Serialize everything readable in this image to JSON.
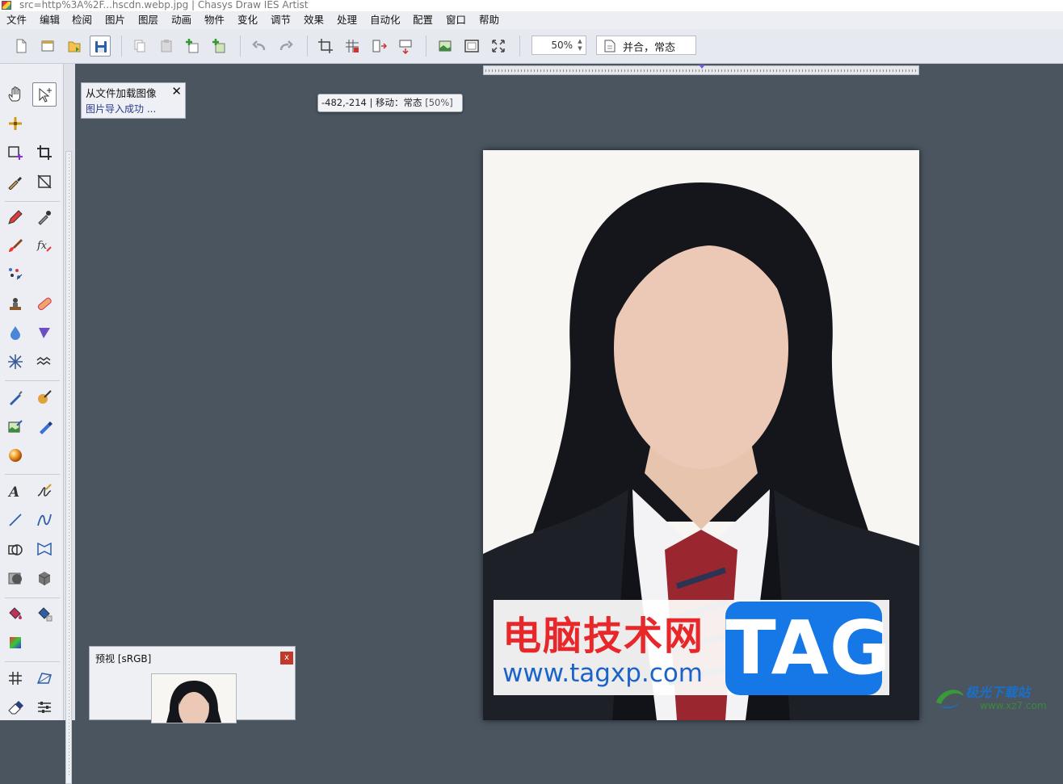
{
  "window": {
    "title": "src=http%3A%2F...hscdn.webp.jpg | Chasys Draw IES Artist"
  },
  "menu": [
    "文件",
    "编辑",
    "检阅",
    "图片",
    "图层",
    "动画",
    "物件",
    "变化",
    "调节",
    "效果",
    "处理",
    "自动化",
    "配置",
    "窗口",
    "帮助"
  ],
  "toolbar": {
    "zoom_value": "50%",
    "blend_mode": "并合，常态",
    "buttons": [
      "new",
      "open",
      "open-folder",
      "save",
      "copy",
      "paste",
      "add-layer",
      "add-layer-from",
      "undo",
      "redo",
      "crop",
      "grid",
      "flip-horizontal",
      "flip-vertical",
      "image",
      "frame",
      "fit-screen"
    ]
  },
  "left_tools": [
    "hand",
    "move-select",
    "add-point",
    "rect-select",
    "crop",
    "eyedropper",
    "transform",
    "pencil",
    "picker-brush",
    "brush",
    "fx-brush",
    "dots",
    "stamp",
    "healing",
    "drop",
    "flag",
    "spark",
    "wave",
    "paint-brush",
    "color-brush",
    "image-edit",
    "marker",
    "sphere",
    "text",
    "signature",
    "line",
    "curve",
    "shapes",
    "warp",
    "sphere-shape",
    "cube",
    "fill",
    "fill-pattern",
    "gradient",
    "grid",
    "transform-grid",
    "eraser",
    "adjust"
  ],
  "notification": {
    "title": "从文件加载图像",
    "message": "图片导入成功 ...",
    "close": "✕"
  },
  "status": {
    "coords": "-482,-214",
    "mode": "移动：常态",
    "zoom": "[50%]"
  },
  "preview": {
    "title": "预视 [sRGB]",
    "close": "x"
  },
  "watermark": {
    "cn_text": "电脑技术网",
    "url": "www.tagxp.com",
    "tag": "TAG"
  },
  "corner_logo": {
    "name": "极光下载站",
    "url": "www.xz7.com"
  },
  "colors": {
    "workspace": "#4a5560",
    "panel": "#eceef3",
    "accent_blue": "#1677e6",
    "watermark_red": "#e8272a"
  }
}
